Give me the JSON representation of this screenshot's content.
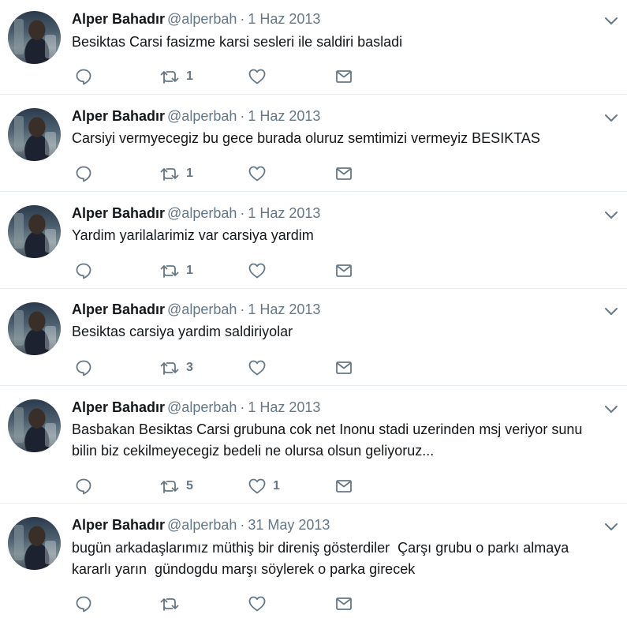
{
  "colors": {
    "text": "#14171a",
    "secondary": "#657786",
    "divider": "#e6ecf0"
  },
  "icons": [
    "reply-icon",
    "retweet-icon",
    "like-icon",
    "message-icon",
    "chevron-down-icon"
  ],
  "tweets": [
    {
      "name": "Alper Bahadır",
      "handle": "@alperbah",
      "sep": "·",
      "date": "1 Haz 2013",
      "text": "Besiktas Carsi fasizme karsi sesleri ile saldiri basladi",
      "retweets": "1",
      "likes": ""
    },
    {
      "name": "Alper Bahadır",
      "handle": "@alperbah",
      "sep": "·",
      "date": "1 Haz 2013",
      "text": "Carsiyi vermyecegiz bu gece burada oluruz semtimizi vermeyiz BESIKTAS",
      "retweets": "1",
      "likes": ""
    },
    {
      "name": "Alper Bahadır",
      "handle": "@alperbah",
      "sep": "·",
      "date": "1 Haz 2013",
      "text": "Yardim yarilalarimiz var carsiya yardim",
      "retweets": "1",
      "likes": ""
    },
    {
      "name": "Alper Bahadır",
      "handle": "@alperbah",
      "sep": "·",
      "date": "1 Haz 2013",
      "text": "Besiktas carsiya yardim saldiriyolar",
      "retweets": "3",
      "likes": ""
    },
    {
      "name": "Alper Bahadır",
      "handle": "@alperbah",
      "sep": "·",
      "date": "1 Haz 2013",
      "text": "Basbakan Besiktas Carsi grubuna cok net Inonu stadi uzerinden msj veriyor sunu\nbilin biz cekilmeyecegiz bedeli ne olursa olsun geliyoruz...",
      "retweets": "5",
      "likes": "1"
    },
    {
      "name": "Alper Bahadır",
      "handle": "@alperbah",
      "sep": "·",
      "date": "31 May 2013",
      "text": "bugün arkadaşlarımız müthiş bir direniş gösterdiler  Çarşı grubu o parkı almaya\nkararlı yarın  gündogdu marşı söylerek o parka girecek",
      "retweets": "",
      "likes": ""
    }
  ]
}
